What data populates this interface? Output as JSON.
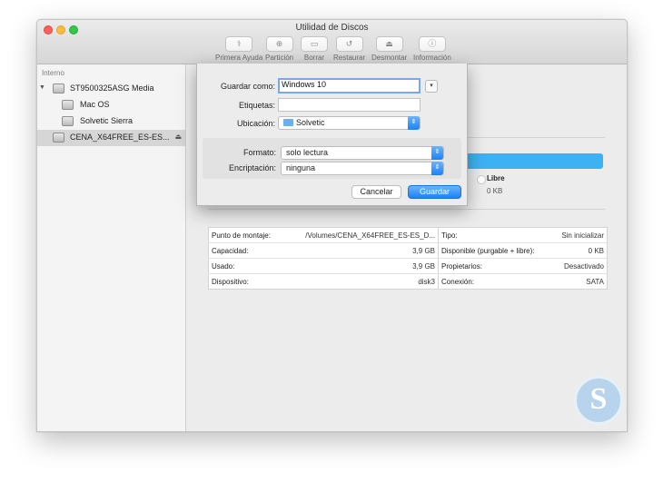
{
  "window": {
    "title": "Utilidad de Discos"
  },
  "toolbar": [
    {
      "label": "Primera Ayuda",
      "icon": "stethoscope-icon"
    },
    {
      "label": "Partición",
      "icon": "partition-icon"
    },
    {
      "label": "Borrar",
      "icon": "erase-icon"
    },
    {
      "label": "Restaurar",
      "icon": "restore-icon"
    },
    {
      "label": "Desmontar",
      "icon": "unmount-icon"
    },
    {
      "label": "Información",
      "icon": "info-icon"
    }
  ],
  "sidebar": {
    "section": "Interno",
    "items": [
      {
        "label": "ST9500325ASG Media",
        "expanded": true
      },
      {
        "label": "Mac OS"
      },
      {
        "label": "Solvetic Sierra"
      },
      {
        "label": "CENA_X64FREE_ES-ES...",
        "selected": true,
        "ejectable": true
      }
    ]
  },
  "usage": {
    "free_label": "Libre",
    "free_value": "0 KB",
    "bar_color": "#3eb1f2"
  },
  "info_table": {
    "left": [
      {
        "key": "Punto de montaje:",
        "value": "/Volumes/CENA_X64FREE_ES-ES_D..."
      },
      {
        "key": "Capacidad:",
        "value": "3,9 GB"
      },
      {
        "key": "Usado:",
        "value": "3,9 GB"
      },
      {
        "key": "Dispositivo:",
        "value": "disk3"
      }
    ],
    "right": [
      {
        "key": "Tipo:",
        "value": "Sin inicializar"
      },
      {
        "key": "Disponible (purgable + libre):",
        "value": "0 KB"
      },
      {
        "key": "Propietarios:",
        "value": "Desactivado"
      },
      {
        "key": "Conexión:",
        "value": "SATA"
      }
    ]
  },
  "save_dialog": {
    "save_as_label": "Guardar como:",
    "save_as_value": "Windows 10",
    "tags_label": "Etiquetas:",
    "tags_value": "",
    "location_label": "Ubicación:",
    "location_value": "Solvetic",
    "format_label": "Formato:",
    "format_value": "solo lectura",
    "encryption_label": "Encriptación:",
    "encryption_value": "ninguna",
    "cancel_label": "Cancelar",
    "save_label": "Guardar",
    "accent": "#1a82fb"
  },
  "logo": {
    "letter": "S"
  }
}
